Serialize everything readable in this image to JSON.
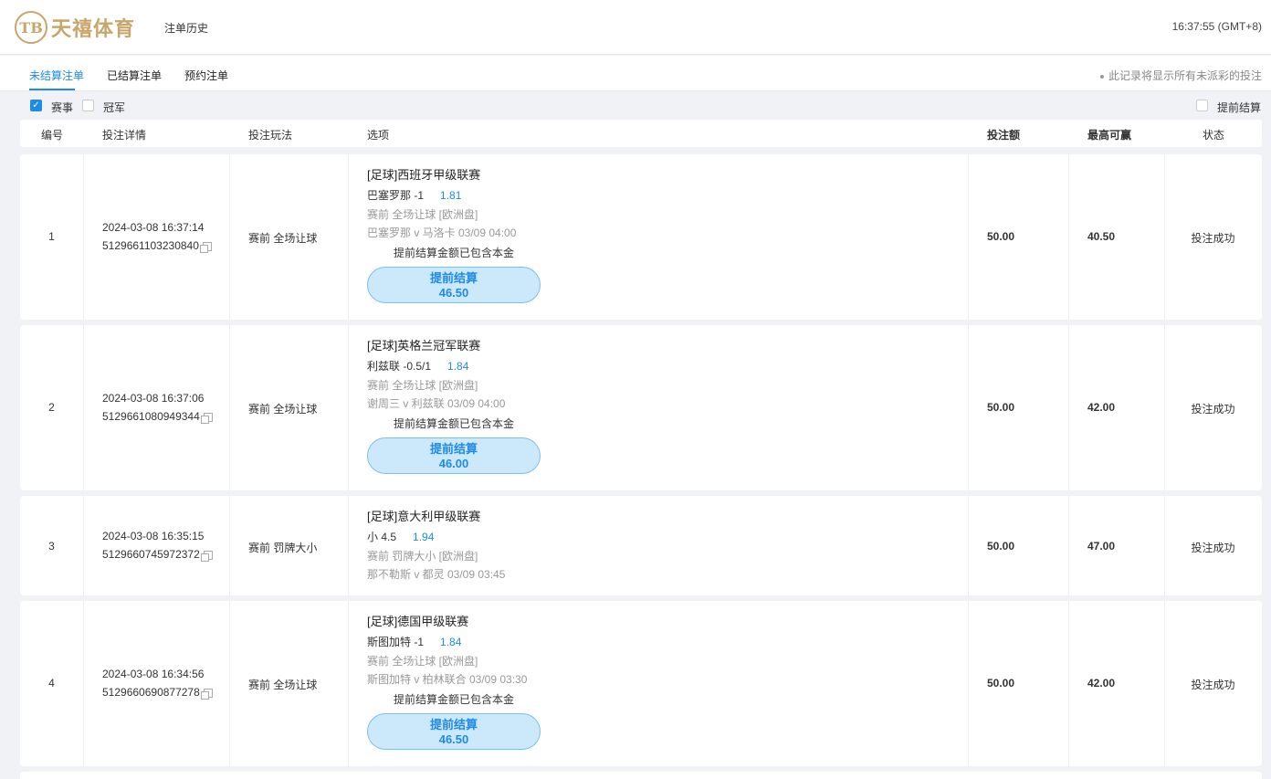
{
  "header": {
    "logo_mark": "TB",
    "logo_text": "天禧体育",
    "title": "注单历史",
    "clock": "16:37:55 (GMT+8)"
  },
  "tabs": [
    {
      "label": "未结算注单",
      "active": true
    },
    {
      "label": "已结算注单",
      "active": false
    },
    {
      "label": "预约注单",
      "active": false
    }
  ],
  "notice": "此记录将显示所有未派彩的投注",
  "filters": {
    "event": "赛事",
    "outright": "冠军",
    "cashout": "提前结算"
  },
  "columns": {
    "no": "编号",
    "detail": "投注详情",
    "play": "投注玩法",
    "selection": "选项",
    "stake": "投注额",
    "max_win": "最高可赢",
    "status": "状态"
  },
  "bets": [
    {
      "no": "1",
      "time": "2024-03-08 16:37:14",
      "id": "5129661103230840",
      "play": "赛前 全场让球",
      "league": "[足球]西班牙甲级联赛",
      "pick": "巴塞罗那 -1",
      "odds": "1.81",
      "market": "赛前   全场让球   [欧洲盘]",
      "match": "巴塞罗那 v 马洛卡    03/09 04:00",
      "note": "提前结算金额已包含本金",
      "cashout_label": "提前结算",
      "cashout_value": "46.50",
      "stake": "50.00",
      "max_win": "40.50",
      "status": "投注成功"
    },
    {
      "no": "2",
      "time": "2024-03-08 16:37:06",
      "id": "5129661080949344",
      "play": "赛前 全场让球",
      "league": "[足球]英格兰冠军联赛",
      "pick": "利兹联 -0.5/1",
      "odds": "1.84",
      "market": "赛前   全场让球   [欧洲盘]",
      "match": "谢周三 v 利兹联    03/09 04:00",
      "note": "提前结算金额已包含本金",
      "cashout_label": "提前结算",
      "cashout_value": "46.00",
      "stake": "50.00",
      "max_win": "42.00",
      "status": "投注成功"
    },
    {
      "no": "3",
      "time": "2024-03-08 16:35:15",
      "id": "5129660745972372",
      "play": "赛前 罚牌大小",
      "league": "[足球]意大利甲级联赛",
      "pick": "小 4.5",
      "odds": "1.94",
      "market": "赛前   罚牌大小   [欧洲盘]",
      "match": "那不勒斯 v 都灵    03/09 03:45",
      "stake": "50.00",
      "max_win": "47.00",
      "status": "投注成功"
    },
    {
      "no": "4",
      "time": "2024-03-08 16:34:56",
      "id": "5129660690877278",
      "play": "赛前 全场让球",
      "league": "[足球]德国甲级联赛",
      "pick": "斯图加特 -1",
      "odds": "1.84",
      "market": "赛前   全场让球   [欧洲盘]",
      "match": "斯图加特 v 柏林联合    03/09 03:30",
      "note": "提前结算金额已包含本金",
      "cashout_label": "提前结算",
      "cashout_value": "46.50",
      "stake": "50.00",
      "max_win": "42.00",
      "status": "投注成功"
    }
  ]
}
